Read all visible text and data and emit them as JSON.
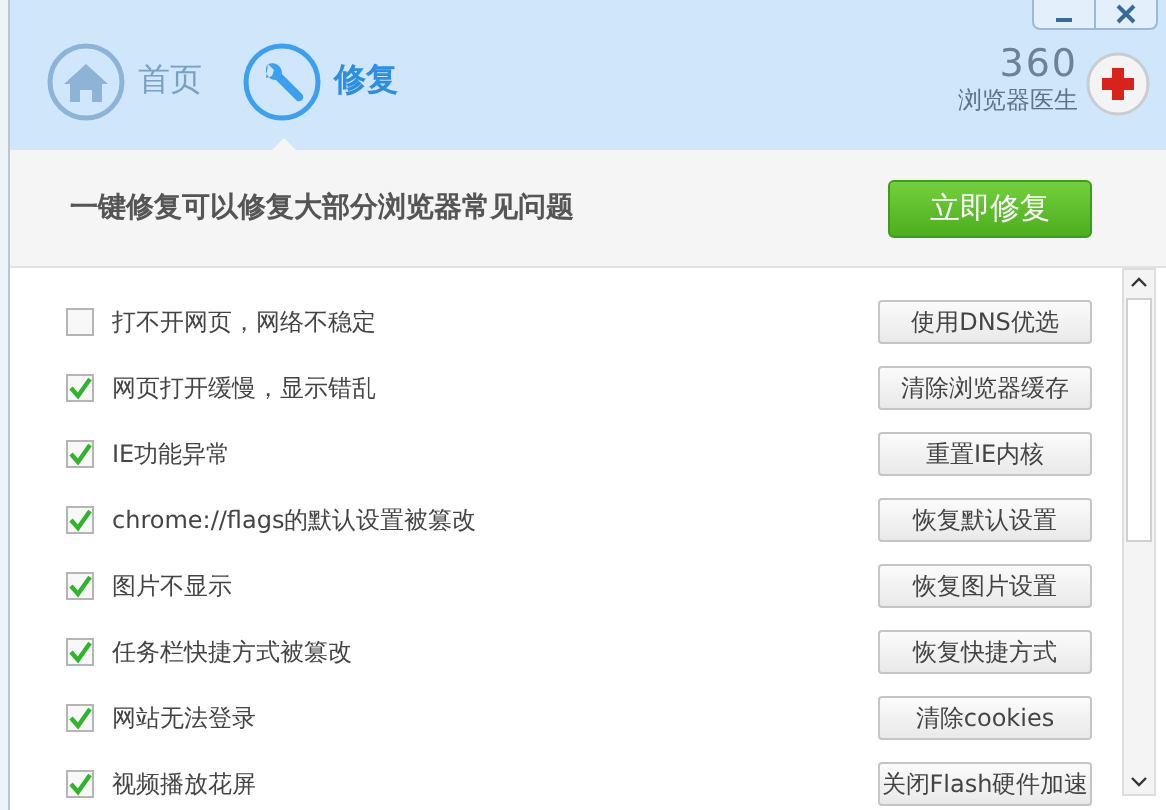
{
  "window": {
    "controls": [
      {
        "kind": "minimize"
      },
      {
        "kind": "close"
      }
    ]
  },
  "tabs": [
    {
      "label": "首页",
      "kind": "home",
      "selected": false
    },
    {
      "label": "修复",
      "kind": "repair",
      "selected": true
    }
  ],
  "logo": {
    "number": "360",
    "name": "浏览器医生"
  },
  "banner": {
    "text": "一键修复可以修复大部分浏览器常见问题",
    "button": "立即修复"
  },
  "issues": [
    {
      "label": "打不开网页，网络不稳定",
      "checked": false,
      "action": "使用DNS优选"
    },
    {
      "label": "网页打开缓慢，显示错乱",
      "checked": true,
      "action": "清除浏览器缓存"
    },
    {
      "label": "IE功能异常",
      "checked": true,
      "action": "重置IE内核"
    },
    {
      "label": "chrome://flags的默认设置被篡改",
      "checked": true,
      "action": "恢复默认设置"
    },
    {
      "label": "图片不显示",
      "checked": true,
      "action": "恢复图片设置"
    },
    {
      "label": "任务栏快捷方式被篡改",
      "checked": true,
      "action": "恢复快捷方式"
    },
    {
      "label": "网站无法登录",
      "checked": true,
      "action": "清除cookies"
    },
    {
      "label": "视频播放花屏",
      "checked": true,
      "action": "关闭Flash硬件加速"
    }
  ]
}
